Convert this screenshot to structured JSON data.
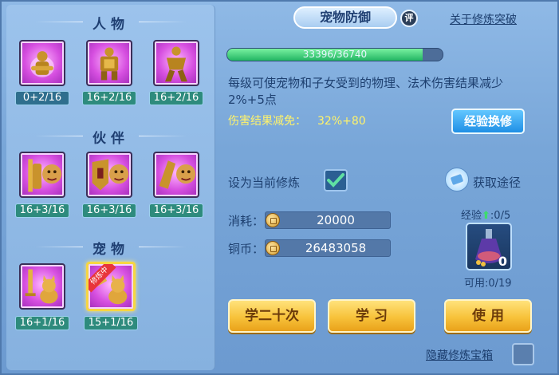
{
  "sections": {
    "character": "人物",
    "partner": "伙伴",
    "pet": "宠物"
  },
  "skills": {
    "character": [
      {
        "level": "0+2/16",
        "icon": "golden-warrior-icon"
      },
      {
        "level": "16+2/16",
        "icon": "armored-warrior-icon"
      },
      {
        "level": "16+2/16",
        "icon": "warrior-stance-icon"
      }
    ],
    "partner": [
      {
        "level": "16+3/16",
        "icon": "partner-sword-icon"
      },
      {
        "level": "16+3/16",
        "icon": "partner-shield-icon"
      },
      {
        "level": "16+3/16",
        "icon": "partner-gauntlet-icon"
      }
    ],
    "pet": [
      {
        "level": "16+1/16",
        "icon": "pet-sword-cat-icon"
      },
      {
        "level": "15+1/16",
        "icon": "pet-defense-cat-icon",
        "ribbon": "修炼中"
      }
    ]
  },
  "detail": {
    "title": "宠物防御",
    "rate_badge": "评",
    "breakthrough_link": "关于修炼突破",
    "progress_text": "33396/36740",
    "progress_fraction": 0.909,
    "description": "每级可使宠物和子女受到的物理、法术伤害结果减少2%+5点",
    "reduction_label": "伤害结果减免：",
    "reduction_value": "32%+80",
    "exp_exchange_button": "经验换修",
    "set_current_label": "设为当前修炼",
    "set_current_checked": true,
    "obtain_link": "获取途径",
    "cost_label": "消耗：",
    "cost_value": "20000",
    "coins_label": "铜币：",
    "coins_value": "26483058",
    "exp_label": "经验",
    "exp_value": ":0/5",
    "potion_count": "0",
    "available_label": "可用:0/19",
    "buttons": {
      "learn_twenty": "学二十次",
      "learn": "学 习",
      "use": "使 用"
    },
    "hide_chest_label": "隐藏修炼宝箱"
  },
  "colors": {
    "accent_gold": "#f7c23a",
    "accent_blue": "#1f8fe5",
    "highlight_yellow": "#fff36a",
    "progress_green": "#22b563"
  }
}
